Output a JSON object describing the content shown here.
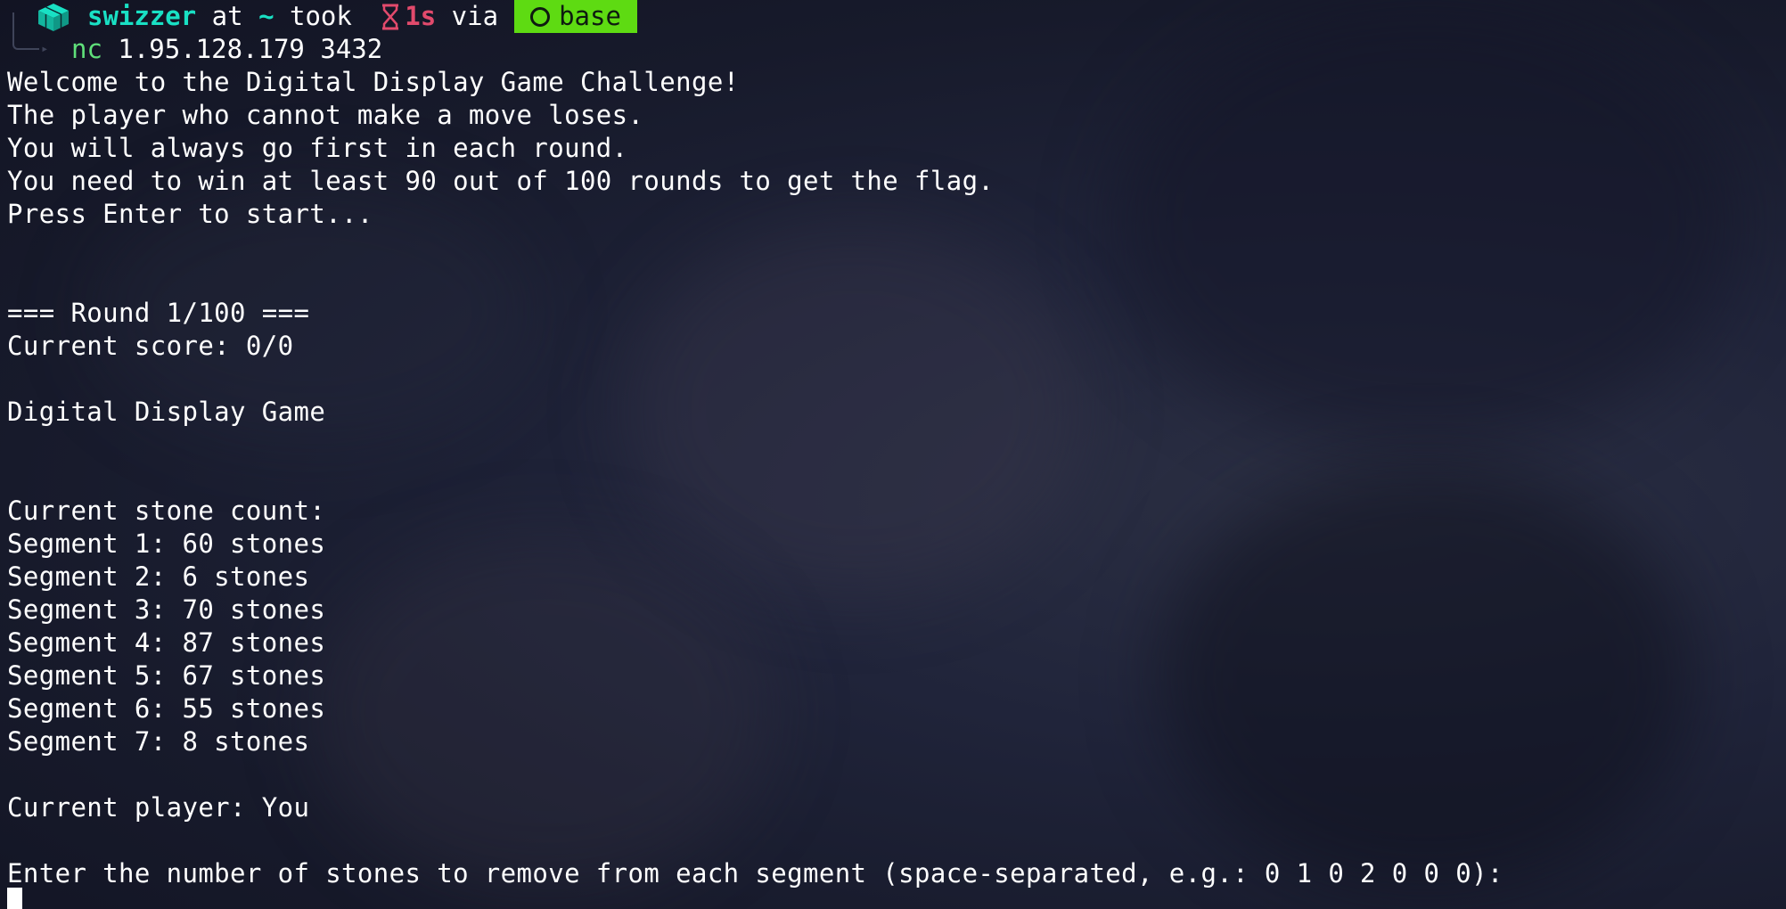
{
  "prompt": {
    "cube_icon": "package-cube-icon",
    "user": "swizzer",
    "at_text": " at ",
    "dir": "~",
    "took_text": " took ",
    "hourglass_icon": "hourglass-icon",
    "duration": "1s",
    "via_text": " via",
    "conda_icon": "circle-icon",
    "conda_env": "base"
  },
  "command": {
    "name": "nc",
    "args": " 1.95.128.179 3432"
  },
  "output": {
    "intro": [
      "Welcome to the Digital Display Game Challenge!",
      "The player who cannot make a move loses.",
      "You will always go first in each round.",
      "You need to win at least 90 out of 100 rounds to get the flag.",
      "Press Enter to start..."
    ],
    "round_header": "=== Round 1/100 ===",
    "score": "Current score: 0/0",
    "game_title": "Digital Display Game",
    "stone_count_header": "Current stone count:",
    "segments": [
      "Segment 1: 60 stones",
      "Segment 2: 6 stones",
      "Segment 3: 70 stones",
      "Segment 4: 87 stones",
      "Segment 5: 67 stones",
      "Segment 6: 55 stones",
      "Segment 7: 8 stones"
    ],
    "current_player": "Current player: You",
    "input_prompt": "Enter the number of stones to remove from each segment (space-separated, e.g.: 0 1 0 2 0 0 0):"
  },
  "colors": {
    "user": "#19e0c4",
    "duration": "#e24a6c",
    "conda_badge": "#5edb12",
    "command": "#5fe07a",
    "text": "#ffffff"
  }
}
